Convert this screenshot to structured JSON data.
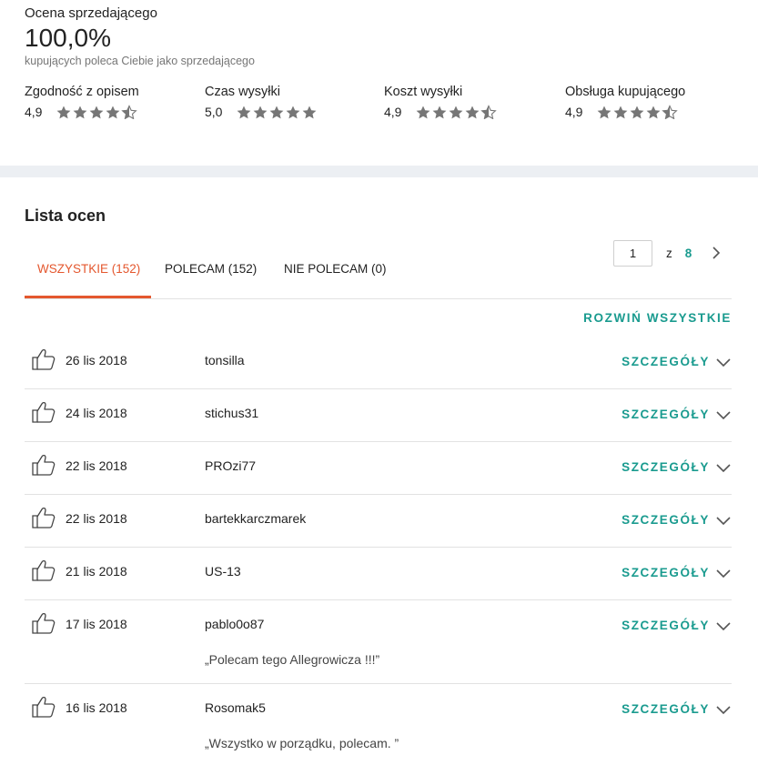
{
  "summary": {
    "label": "Ocena sprzedającego",
    "value": "100,0%",
    "sub": "kupujących poleca Ciebie jako sprzedającego"
  },
  "criteria": [
    {
      "name": "Zgodność z opisem",
      "score": "4,9",
      "rating": 4.5
    },
    {
      "name": "Czas wysyłki",
      "score": "5,0",
      "rating": 5
    },
    {
      "name": "Koszt wysyłki",
      "score": "4,9",
      "rating": 4.5
    },
    {
      "name": "Obsługa kupującego",
      "score": "4,9",
      "rating": 4.5
    }
  ],
  "list": {
    "title": "Lista ocen",
    "expand_all": "ROZWIŃ WSZYSTKIE",
    "details_label": "SZCZEGÓŁY"
  },
  "tabs": [
    {
      "label": "WSZYSTKIE (152)",
      "active": true
    },
    {
      "label": "POLECAM (152)",
      "active": false
    },
    {
      "label": "NIE POLECAM (0)",
      "active": false
    }
  ],
  "pager": {
    "current": "1",
    "of": "z",
    "total": "8"
  },
  "colors": {
    "accent": "#1a9b8f",
    "active_tab": "#e4572e",
    "star": "#767676"
  },
  "rows": [
    {
      "date": "26 lis 2018",
      "user": "tonsilla",
      "comment": ""
    },
    {
      "date": "24 lis 2018",
      "user": "stichus31",
      "comment": ""
    },
    {
      "date": "22 lis 2018",
      "user": "PROzi77",
      "comment": ""
    },
    {
      "date": "22 lis 2018",
      "user": "bartekkarczmarek",
      "comment": ""
    },
    {
      "date": "21 lis 2018",
      "user": "US-13",
      "comment": ""
    },
    {
      "date": "17 lis 2018",
      "user": "pablo0o87",
      "comment": "„Polecam tego Allegrowicza !!!”"
    },
    {
      "date": "16 lis 2018",
      "user": "Rosomak5",
      "comment": "„Wszystko w porządku, polecam. ”"
    }
  ]
}
